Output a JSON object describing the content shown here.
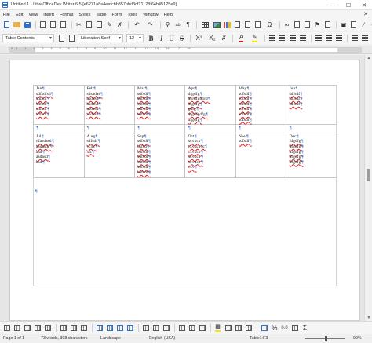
{
  "window": {
    "title": "Untitled 1 - LibreOfficeDev Writer 6.5 [e6271a8a4eafcbb357bbd3cf21128f64b45125e9]",
    "minimize": "—",
    "maximize": "☐",
    "close": "✕"
  },
  "menu": {
    "items": [
      "File",
      "Edit",
      "View",
      "Insert",
      "Format",
      "Styles",
      "Table",
      "Form",
      "Tools",
      "Window",
      "Help"
    ],
    "close_doc": "✕"
  },
  "toolbar2": {
    "paragraph_style": "Table Contents",
    "font_name": "Liberation Serif",
    "font_size": "12",
    "bold": "B",
    "italic": "I",
    "underline": "U",
    "strikethrough": "S",
    "superscript": "X²",
    "subscript": "X₂",
    "font_color_glyph": "A"
  },
  "toolbar1": {
    "special_char": "Ω",
    "undo": "↶",
    "redo": "↷",
    "abc": "ab",
    "pilcrow": "¶"
  },
  "ruler": {
    "numbers": "2 . 1 . . . 1 . . . 2 . . . 3 . . . 4 . . . 5 . . . 6 . . . 7 . . . 8 . . . 9 . . . 10 . . . 11 . . . 12 . . . 13 . . . 14 . . . 15 . . . 16 . . . 17 . . . 18"
  },
  "table": {
    "row1": [
      {
        "lines": [
          "Jan",
          "sdfsdfsd",
          "sdfsdf",
          "sdfsdf",
          "sdfsdf",
          "sdfsdf"
        ]
      },
      {
        "lines": [
          "Feb",
          "sdsadas",
          "asdasd",
          "asdasd",
          "asdasd",
          "asdasd"
        ]
      },
      {
        "lines": [
          "Mar",
          "sdfsdf",
          "sdfsdf",
          "sdfsdf",
          "sdfsdf",
          "sdfsdf"
        ]
      },
      {
        "lines": [
          "Apr",
          "dfgdfg",
          "dfgdfgdfgd",
          "dfgdfg",
          "gdfg",
          "dfgdfgdfg",
          "dfgdfg"
        ]
      },
      {
        "lines": [
          "May",
          "sdfsdf",
          "sdfsdf",
          "sdfsdf",
          "sdfsdf",
          "sdfsdf",
          "sdfsdf"
        ]
      },
      {
        "lines": [
          "Jun",
          "sdfsdf",
          "sdfsdf",
          "sdfsdf"
        ]
      }
    ],
    "row2": [
      {
        "lines": [
          "Jul",
          "dfasdasd",
          "asdasda",
          "asd",
          "asdasd",
          "asd"
        ]
      },
      {
        "lines": [
          "A ug",
          "sdfsdf",
          "vcxc",
          "\\zc"
        ]
      },
      {
        "lines": [
          "Sep",
          "sdfsdf",
          "dsfsd",
          "sdfsdf",
          "sdfsdf",
          "sdfsdf",
          "sdfsdf",
          "sdfsdf"
        ]
      },
      {
        "lines": [
          "Oct",
          "xcvxcv",
          "cxvxcvxc",
          "cxvxcv",
          "xcvxcv",
          "xcvxcv",
          "cxv"
        ]
      },
      {
        "lines": [
          "Nov",
          "sdfsdf"
        ]
      },
      {
        "lines": [
          "Dec",
          "fdgdfg",
          "dfgdfg",
          "dfgdfg",
          "dfgdfg",
          "dfgdfg"
        ]
      }
    ],
    "pilcrow": "¶"
  },
  "statusbar": {
    "page": "Page 1 of 1",
    "words": "73 words, 398 characters",
    "page_style": "Landscape",
    "language": "English (USA)",
    "cell": "Table1:F3",
    "zoom": "90%"
  },
  "bottom_toolbar": {
    "percent": "%",
    "permille": "0.0"
  }
}
